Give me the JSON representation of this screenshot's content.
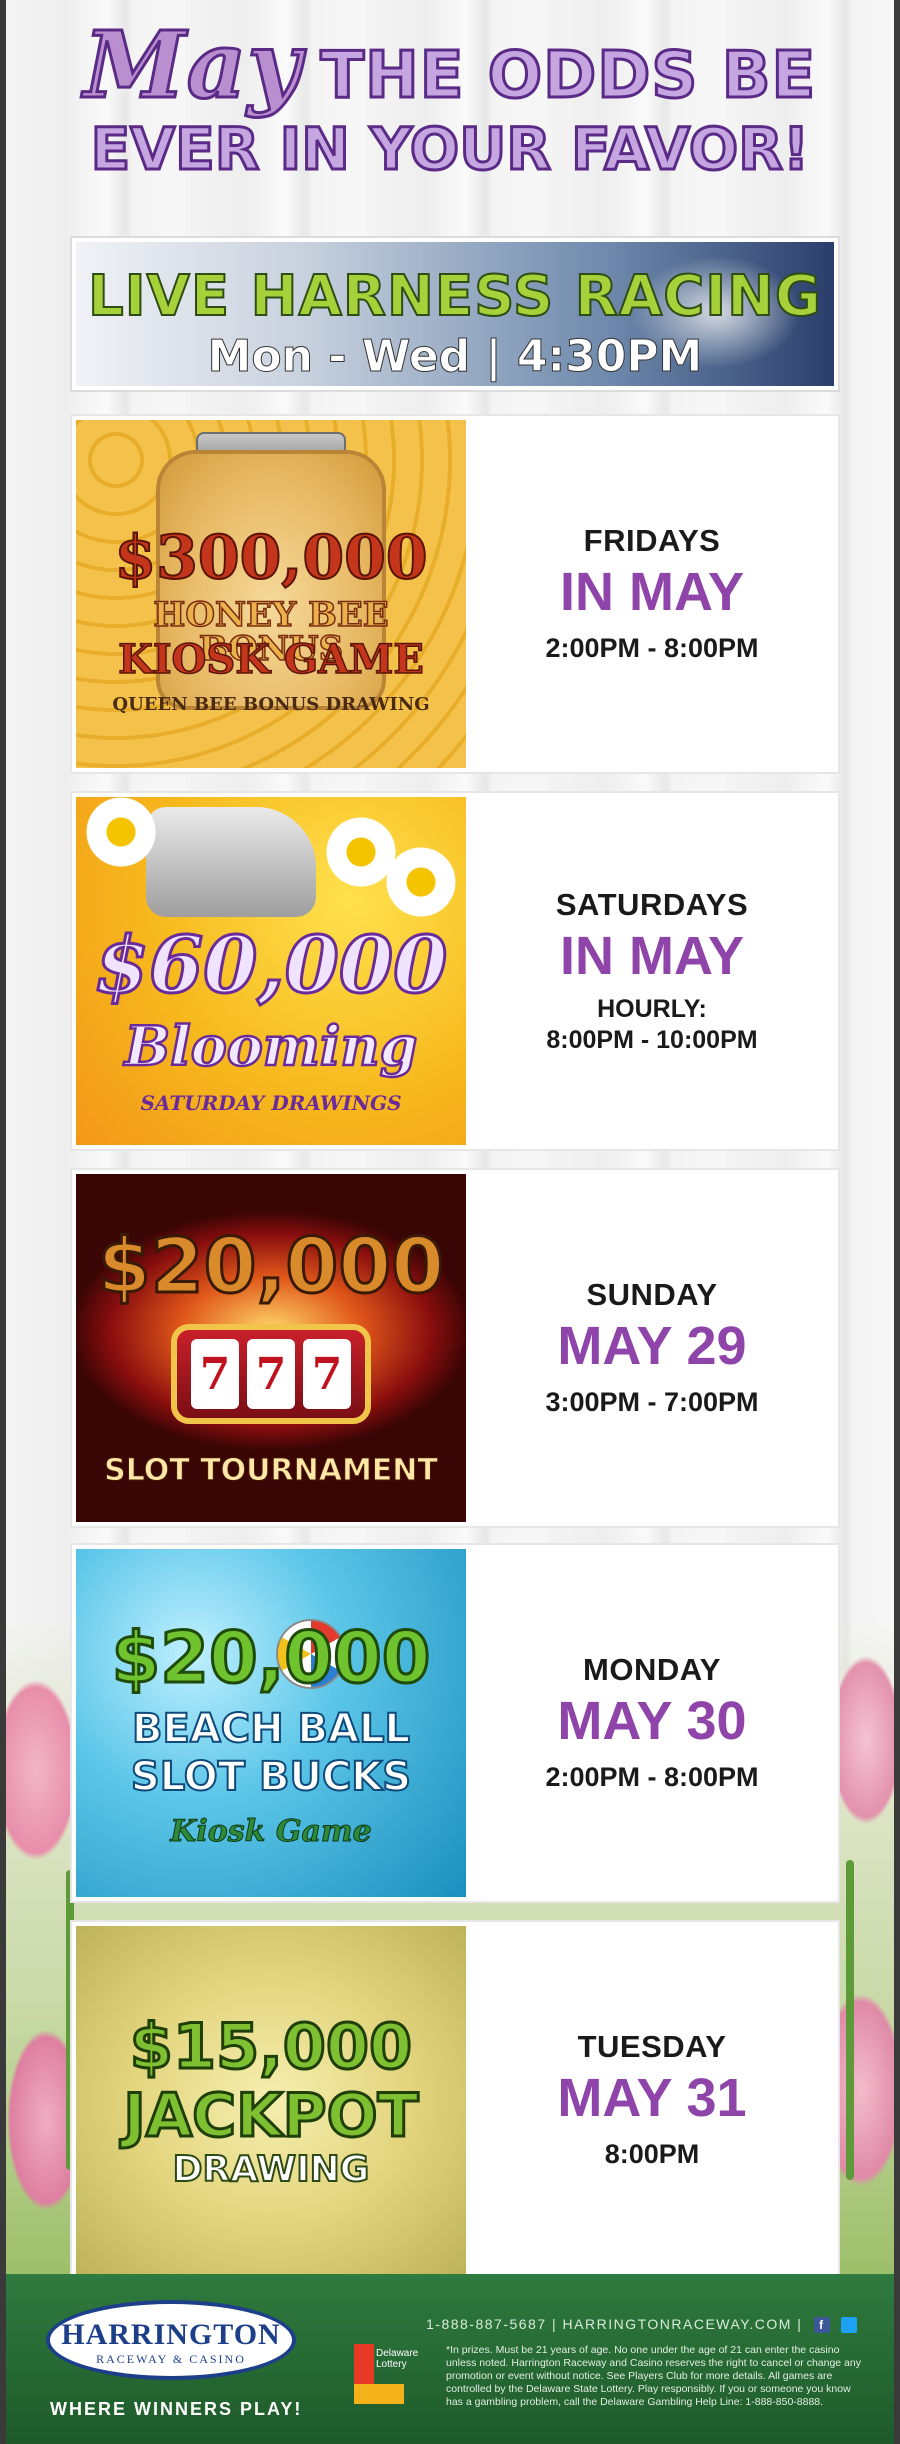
{
  "header": {
    "may": "May",
    "line1_rest": "THE ODDS BE",
    "line2": "EVER IN YOUR FAVOR!"
  },
  "banner": {
    "title": "LIVE HARNESS RACING",
    "schedule": "Mon - Wed | 4:30PM"
  },
  "promos": [
    {
      "art": {
        "amount": "$300,000",
        "line2": "HONEY BEE BONUS",
        "line3": "KIOSK GAME",
        "line4": "QUEEN BEE BONUS DRAWING"
      },
      "day": "FRIDAYS",
      "date": "IN MAY",
      "time": "2:00PM - 8:00PM"
    },
    {
      "art": {
        "amount": "$60,000",
        "line2": "Blooming",
        "line3": "SATURDAY DRAWINGS"
      },
      "day": "SATURDAYS",
      "date": "IN MAY",
      "time_prefix": "HOURLY:",
      "time": "8:00PM - 10:00PM"
    },
    {
      "art": {
        "amount": "$20,000",
        "reels": [
          "7",
          "7",
          "7"
        ],
        "line2": "SLOT TOURNAMENT"
      },
      "day": "SUNDAY",
      "date": "MAY 29",
      "time": "3:00PM - 7:00PM"
    },
    {
      "art": {
        "amount": "$20,000",
        "line2": "BEACH BALL",
        "line3": "SLOT BUCKS",
        "line4": "Kiosk Game"
      },
      "day": "MONDAY",
      "date": "MAY 30",
      "time": "2:00PM - 8:00PM"
    },
    {
      "art": {
        "amount": "$15,000",
        "line2": "JACKPOT",
        "line3": "DRAWING"
      },
      "day": "TUESDAY",
      "date": "MAY 31",
      "time": "8:00PM"
    }
  ],
  "footer": {
    "logo_main": "HARRINGTON",
    "logo_sub": "RACEWAY & CASINO",
    "tagline": "WHERE WINNERS PLAY!",
    "lottery_text": "Delaware Lottery",
    "contact": "1-888-887-5687 | HARRINGTONRACEWAY.COM |",
    "facebook": "f",
    "legal": "*In prizes. Must be 21 years of age. No one under the age of 21 can enter the casino unless noted. Harrington Raceway and Casino reserves the right to cancel or change any promotion or event without notice. See Players Club for more details. All games are controlled by the Delaware State Lottery. Play responsibly. If you or someone you know has a gambling problem, call the Delaware Gambling Help Line: 1-888-850-8888."
  },
  "colors": {
    "accent_purple": "#8e44a8",
    "banner_green": "#a7d13a",
    "footer_green": "#2f7a3e",
    "logo_blue": "#1d3f8a"
  }
}
